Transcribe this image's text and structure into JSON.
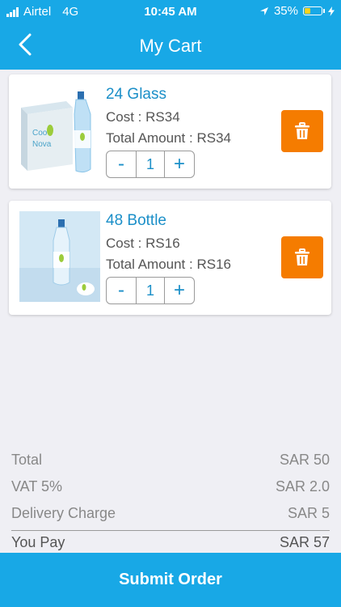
{
  "status_bar": {
    "carrier": "Airtel",
    "network": "4G",
    "time": "10:45 AM",
    "battery": "35%",
    "battery_level": 0.35
  },
  "header": {
    "title": "My Cart",
    "back_icon": "chevron-left-icon"
  },
  "cart": {
    "items": [
      {
        "name": "24 Glass",
        "cost": "Cost : RS34",
        "total": "Total Amount : RS34",
        "qty": "1",
        "minus": "-",
        "plus": "+"
      },
      {
        "name": "48 Bottle",
        "cost": "Cost : RS16",
        "total": "Total Amount : RS16",
        "qty": "1",
        "minus": "-",
        "plus": "+"
      }
    ]
  },
  "summary": {
    "total_label": "Total",
    "total_value": "SAR 50",
    "vat_label": "VAT 5%",
    "vat_value": "SAR 2.0",
    "delivery_label": "Delivery Charge",
    "delivery_value": "SAR 5",
    "pay_label": "You Pay",
    "pay_value": "SAR 57"
  },
  "footer": {
    "submit_label": "Submit Order"
  },
  "colors": {
    "primary": "#18a8e6",
    "accent": "#f57c00",
    "link": "#1b8fc8"
  }
}
